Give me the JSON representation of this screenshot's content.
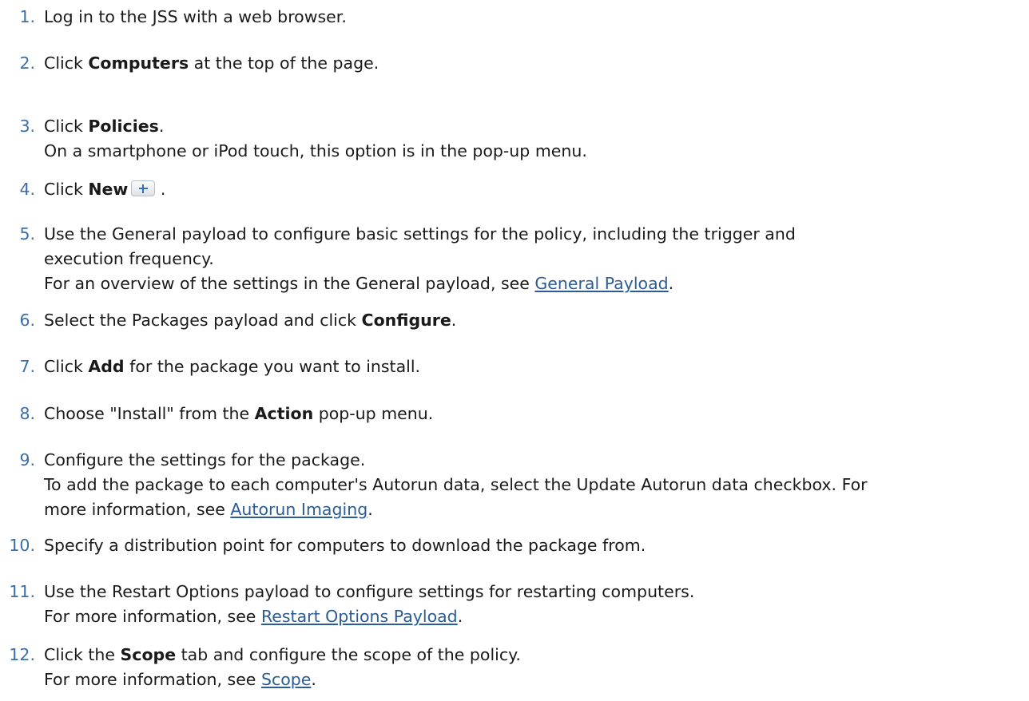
{
  "steps": [
    {
      "number": "1.",
      "parts": [
        {
          "t": "Log in to the JSS with a web browser."
        }
      ]
    },
    {
      "number": "2.",
      "parts": [
        {
          "t": "Click "
        },
        {
          "b": "Computers"
        },
        {
          "t": " at the top of the page."
        }
      ]
    },
    {
      "number": "3.",
      "parts": [
        {
          "t": "Click "
        },
        {
          "b": "Policies"
        },
        {
          "t": "."
        }
      ],
      "note": [
        {
          "t": "On a smartphone or iPod touch, this option is in the pop-up menu."
        }
      ]
    },
    {
      "number": "4.",
      "parts": [
        {
          "t": "Click "
        },
        {
          "b": "New"
        },
        {
          "icon": "plus-icon"
        },
        {
          "t": " ."
        }
      ]
    },
    {
      "number": "5.",
      "parts": [
        {
          "t": "Use the General payload to configure basic settings for the policy, including the trigger and"
        }
      ],
      "cont": [
        {
          "t": "execution frequency."
        }
      ],
      "note": [
        {
          "t": "For an overview of the settings in the General payload, see "
        },
        {
          "link": "General Payload"
        },
        {
          "t": "."
        }
      ]
    },
    {
      "number": "6.",
      "parts": [
        {
          "t": "Select the Packages payload and click "
        },
        {
          "b": "Configure"
        },
        {
          "t": "."
        }
      ]
    },
    {
      "number": "7.",
      "parts": [
        {
          "t": "Click "
        },
        {
          "b": "Add"
        },
        {
          "t": " for the package you want to install."
        }
      ]
    },
    {
      "number": "8.",
      "parts": [
        {
          "t": "Choose \"Install\" from the "
        },
        {
          "b": "Action"
        },
        {
          "t": " pop-up menu."
        }
      ]
    },
    {
      "number": "9.",
      "parts": [
        {
          "t": "Configure the settings for the package."
        }
      ],
      "note": [
        {
          "t": "To add the package to each computer's Autorun data, select the Update Autorun data checkbox. For"
        }
      ],
      "note2": [
        {
          "t": "more information, see "
        },
        {
          "link": "Autorun Imaging"
        },
        {
          "t": "."
        }
      ]
    },
    {
      "number": "10.",
      "parts": [
        {
          "t": "Specify a distribution point for computers to download the package from."
        }
      ]
    },
    {
      "number": "11.",
      "parts": [
        {
          "t": "Use the Restart Options payload to configure settings for restarting computers."
        }
      ],
      "note": [
        {
          "t": "For more information, see "
        },
        {
          "link": "Restart Options Payload"
        },
        {
          "t": "."
        }
      ]
    },
    {
      "number": "12.",
      "parts": [
        {
          "t": "Click the "
        },
        {
          "b": "Scope"
        },
        {
          "t": " tab and configure the scope of the policy."
        }
      ],
      "note": [
        {
          "t": "For more information, see "
        },
        {
          "link": "Scope"
        },
        {
          "t": "."
        }
      ]
    }
  ]
}
